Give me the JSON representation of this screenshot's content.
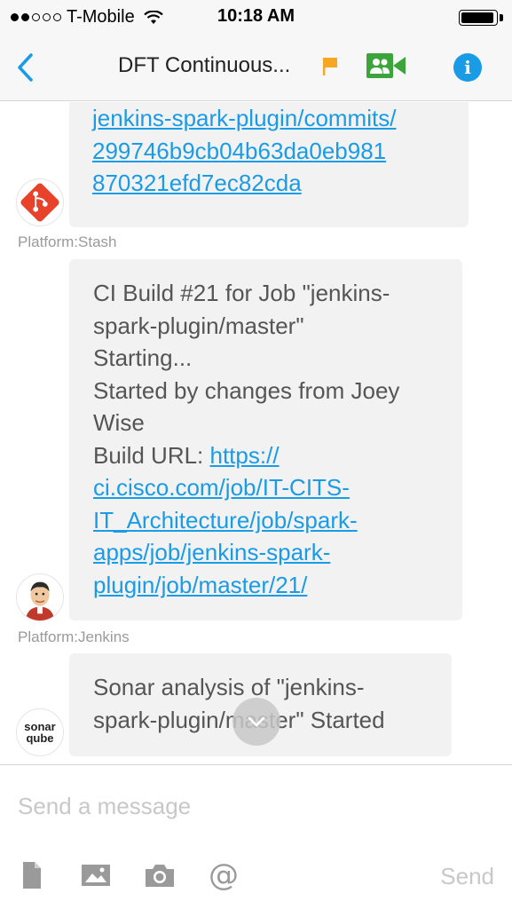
{
  "status_bar": {
    "carrier": "T-Mobile",
    "time": "10:18 AM",
    "signal_bars": 2,
    "signal_max": 5,
    "battery_level": 0.95
  },
  "nav": {
    "title": "DFT Continuous...",
    "back_icon": "chevron-left-icon",
    "flag_icon": "flag-icon",
    "video_icon": "group-video-icon",
    "info_icon": "info-icon",
    "info_label": "i",
    "accent_color": "#1a9be6",
    "flag_color": "#f5a623",
    "video_color": "#3ba53b"
  },
  "messages": [
    {
      "sender": "Platform:Stash",
      "avatar_icon": "stash-logo-icon",
      "link_lines": [
        "jenkins-spark-plugin/commits/",
        "299746b9cb04b63da0eb981",
        "870321efd7ec82cda"
      ]
    },
    {
      "sender": "Platform:Jenkins",
      "avatar_icon": "jenkins-logo-icon",
      "text_lines": [
        "CI Build #21 for Job \"jenkins-",
        "spark-plugin/master\"",
        "Starting...",
        "Started by changes from Joey",
        "Wise"
      ],
      "build_url_label": "Build URL: ",
      "link_first": "https://",
      "link_lines": [
        "ci.cisco.com/job/IT-CITS-",
        "IT_Architecture/job/spark-",
        "apps/job/jenkins-spark-",
        "plugin/job/master/21/"
      ]
    },
    {
      "sender": "",
      "avatar_icon": "sonarqube-logo-icon",
      "avatar_text_1": "sonar",
      "avatar_text_2": "qube",
      "text_lines": [
        "Sonar analysis of \"jenkins-",
        "spark-plugin/master\" Started"
      ]
    }
  ],
  "composer": {
    "placeholder": "Send a message",
    "send_label": "Send",
    "tools": [
      "document-icon",
      "image-icon",
      "camera-icon",
      "at-icon"
    ],
    "at_symbol": "@"
  }
}
